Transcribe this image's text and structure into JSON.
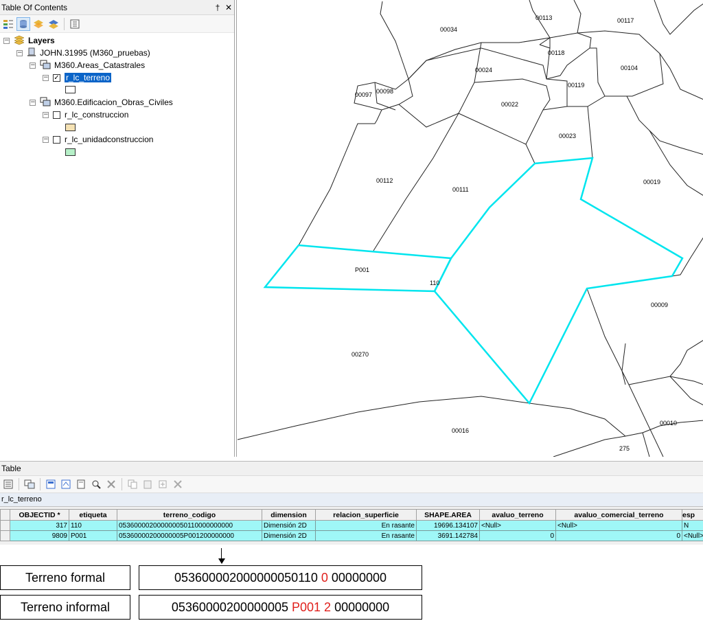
{
  "toc": {
    "title": "Table Of Contents",
    "pin_glyph": "†",
    "close_glyph": "✕",
    "layers_root": "Layers",
    "data_frame": "JOHN.31995 (M360_pruebas)",
    "group1": "M360.Areas_Catastrales",
    "layer1": "r_lc_terreno",
    "group2": "M360.Edificacion_Obras_Civiles",
    "layer2": "r_lc_construccion",
    "layer3": "r_lc_unidadconstruccion",
    "collapse_glyph": "−",
    "check_glyph": "✓",
    "symbol_colors": {
      "layer1": "#ffffff",
      "layer2": "#f5e2b4",
      "layer3": "#b6f0c8"
    }
  },
  "map": {
    "selection_color": "#00e5ee",
    "labels": {
      "p00113": "00113",
      "p00117": "00117",
      "p00034": "00034",
      "p00118": "00118",
      "p00024": "00024",
      "p00104": "00104",
      "p00098": "00098",
      "p00097": "00097",
      "p00119": "00119",
      "p00022": "00022",
      "p00023": "00023",
      "p00112": "00112",
      "p00111": "00111",
      "p00019": "00019",
      "pP001": "P001",
      "p110": "110",
      "p00009": "00009",
      "p00270": "00270",
      "p00016": "00016",
      "p00010": "00010",
      "p275": "275"
    }
  },
  "table": {
    "title": "Table",
    "tab": "r_lc_terreno",
    "columns": [
      "OBJECTID *",
      "etiqueta",
      "terreno_codigo",
      "dimension",
      "relacion_superficie",
      "SHAPE.AREA",
      "avaluo_terreno",
      "avaluo_comercial_terreno",
      "esp"
    ],
    "rows": [
      [
        "317",
        "110",
        "053600002000000050110000000000",
        "Dimensión 2D",
        "En rasante",
        "19696.134107",
        "<Null>",
        "<Null>",
        "N"
      ],
      [
        "9809",
        "P001",
        "05360000200000005P001200000000",
        "Dimensión 2D",
        "En rasante",
        "3691.142784",
        "0",
        "0",
        "<Null>"
      ]
    ]
  },
  "annotation": {
    "formal_label": "Terreno formal",
    "formal_code_a": "053600002000000050110 ",
    "formal_code_b": "0",
    "formal_code_c": " 00000000",
    "informal_label": "Terreno informal",
    "informal_code_a": "05360000200000005 ",
    "informal_code_b": "P001 2",
    "informal_code_c": " 00000000"
  }
}
